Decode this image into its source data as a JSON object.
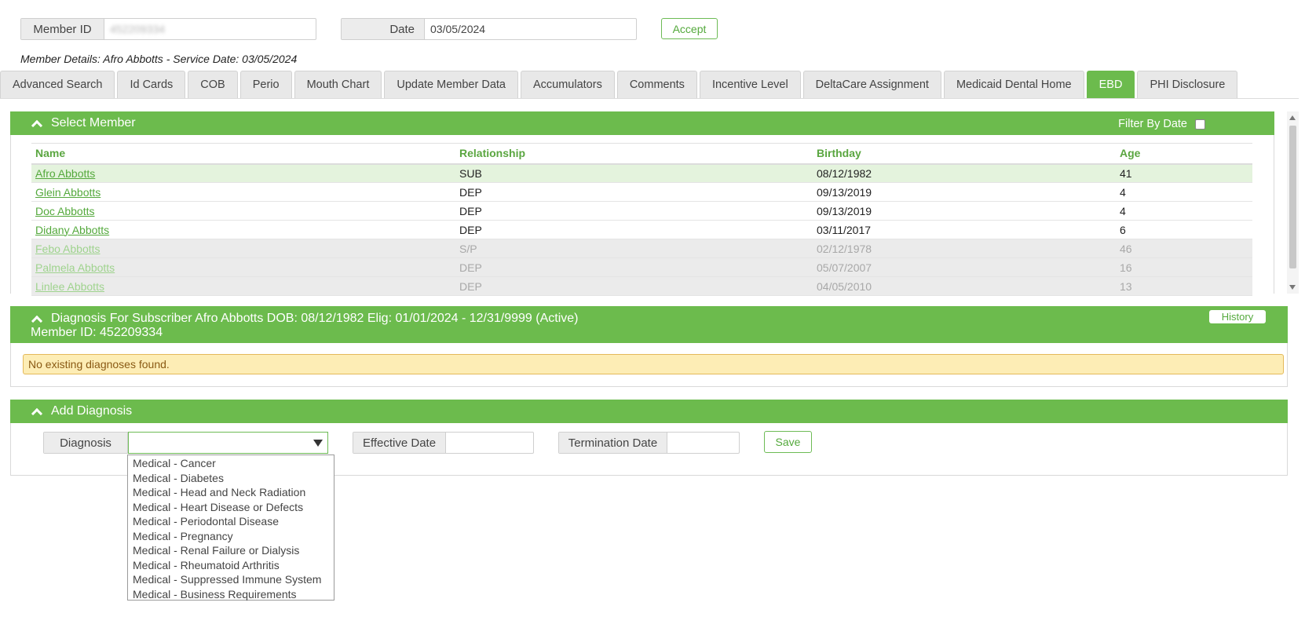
{
  "lookup": {
    "member_id_label": "Member ID",
    "member_id_value": "452209334",
    "date_label": "Date",
    "date_value": "03/05/2024",
    "accept_label": "Accept"
  },
  "member_details": "Member Details: Afro Abbotts - Service Date: 03/05/2024",
  "tabs": [
    {
      "label": "Advanced Search"
    },
    {
      "label": "Id Cards"
    },
    {
      "label": "COB"
    },
    {
      "label": "Perio"
    },
    {
      "label": "Mouth Chart"
    },
    {
      "label": "Update Member Data"
    },
    {
      "label": "Accumulators"
    },
    {
      "label": "Comments"
    },
    {
      "label": "Incentive Level"
    },
    {
      "label": "DeltaCare Assignment"
    },
    {
      "label": "Medicaid Dental Home"
    },
    {
      "label": "EBD",
      "active": true
    },
    {
      "label": "PHI Disclosure"
    }
  ],
  "select_member": {
    "title": "Select Member",
    "filter_label": "Filter By Date",
    "columns": [
      "Name",
      "Relationship",
      "Birthday",
      "Age"
    ],
    "rows": [
      {
        "name": "Afro Abbotts",
        "relationship": "SUB",
        "birthday": "08/12/1982",
        "age": "41",
        "state": "selected"
      },
      {
        "name": "Glein Abbotts",
        "relationship": "DEP",
        "birthday": "09/13/2019",
        "age": "4",
        "state": "active"
      },
      {
        "name": "Doc Abbotts",
        "relationship": "DEP",
        "birthday": "09/13/2019",
        "age": "4",
        "state": "active"
      },
      {
        "name": "Didany Abbotts",
        "relationship": "DEP",
        "birthday": "03/11/2017",
        "age": "6",
        "state": "active"
      },
      {
        "name": "Febo Abbotts",
        "relationship": "S/P",
        "birthday": "02/12/1978",
        "age": "46",
        "state": "inactive"
      },
      {
        "name": "Palmela Abbotts",
        "relationship": "DEP",
        "birthday": "05/07/2007",
        "age": "16",
        "state": "inactive"
      },
      {
        "name": "Linlee Abbotts",
        "relationship": "DEP",
        "birthday": "04/05/2010",
        "age": "13",
        "state": "inactive"
      }
    ]
  },
  "diagnosis_panel": {
    "title": "Diagnosis For Subscriber Afro Abbotts DOB: 08/12/1982 Elig: 01/01/2024 - 12/31/9999 (Active)",
    "member_id_line": "Member ID: 452209334",
    "history_label": "History",
    "empty_message": "No existing diagnoses found."
  },
  "add_diagnosis": {
    "title": "Add Diagnosis",
    "diagnosis_label": "Diagnosis",
    "diagnosis_value": "",
    "effective_date_label": "Effective Date",
    "effective_date_value": "",
    "termination_date_label": "Termination Date",
    "termination_date_value": "",
    "save_label": "Save",
    "options": [
      "Medical - Cancer",
      "Medical - Diabetes",
      "Medical - Head and Neck Radiation",
      "Medical - Heart Disease or Defects",
      "Medical - Periodontal Disease",
      "Medical - Pregnancy",
      "Medical - Renal Failure or Dialysis",
      "Medical - Rheumatoid Arthritis",
      "Medical - Suppressed Immune System",
      "Medical - Business Requirements"
    ]
  },
  "colors": {
    "brand_green": "#6cbb4d",
    "link_green": "#54a93c",
    "warning_bg": "#fdedb5"
  }
}
